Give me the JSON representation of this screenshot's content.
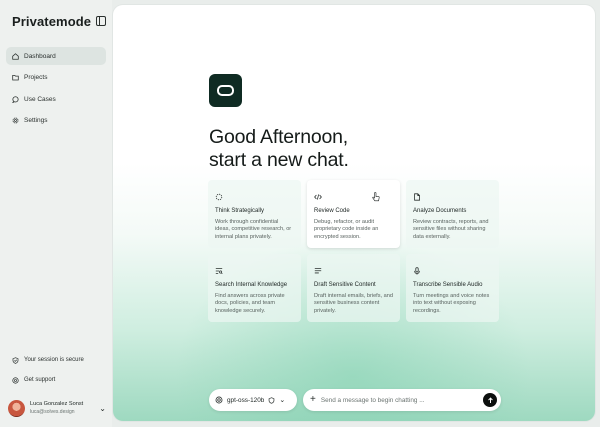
{
  "brand": {
    "name": "Privatemode"
  },
  "sidebar": {
    "items": [
      {
        "label": "Dashboard",
        "icon": "home-icon",
        "active": true
      },
      {
        "label": "Projects",
        "icon": "folder-icon",
        "active": false
      },
      {
        "label": "Use Cases",
        "icon": "chat-bubble-icon",
        "active": false
      },
      {
        "label": "Settings",
        "icon": "gear-icon",
        "active": false
      }
    ],
    "session_label": "Your session is secure",
    "support_label": "Get support",
    "user": {
      "name": "Luca Gonzalez Sonst",
      "email": "luca@solves.design"
    }
  },
  "main": {
    "greeting_line1": "Good Afternoon,",
    "greeting_line2": "start a new chat.",
    "cards": [
      {
        "title": "Think Strategically",
        "desc": "Work through confidential ideas, competitive research, or internal plans privately.",
        "icon": "spark-icon"
      },
      {
        "title": "Review Code",
        "desc": "Debug, refactor, or audit proprietary code inside an encrypted session.",
        "icon": "code-icon"
      },
      {
        "title": "Analyze Documents",
        "desc": "Review contracts, reports, and sensitive files without sharing data externally.",
        "icon": "document-icon"
      },
      {
        "title": "Search Internal Knowledge",
        "desc": "Find answers across private docs, policies, and team knowledge securely.",
        "icon": "search-list-icon"
      },
      {
        "title": "Draft Sensitive Content",
        "desc": "Draft internal emails, briefs, and sensitive business content privately.",
        "icon": "text-lines-icon"
      },
      {
        "title": "Transcribe Sensible Audio",
        "desc": "Turn meetings and voice notes into text without exposing recordings.",
        "icon": "microphone-icon"
      }
    ],
    "model": {
      "name": "gpt-oss-120b"
    },
    "chat": {
      "placeholder": "Send a message to begin chatting ..."
    }
  },
  "colors": {
    "brand_dark": "#0f2b23",
    "accent_mint": "#9ed9c0"
  }
}
